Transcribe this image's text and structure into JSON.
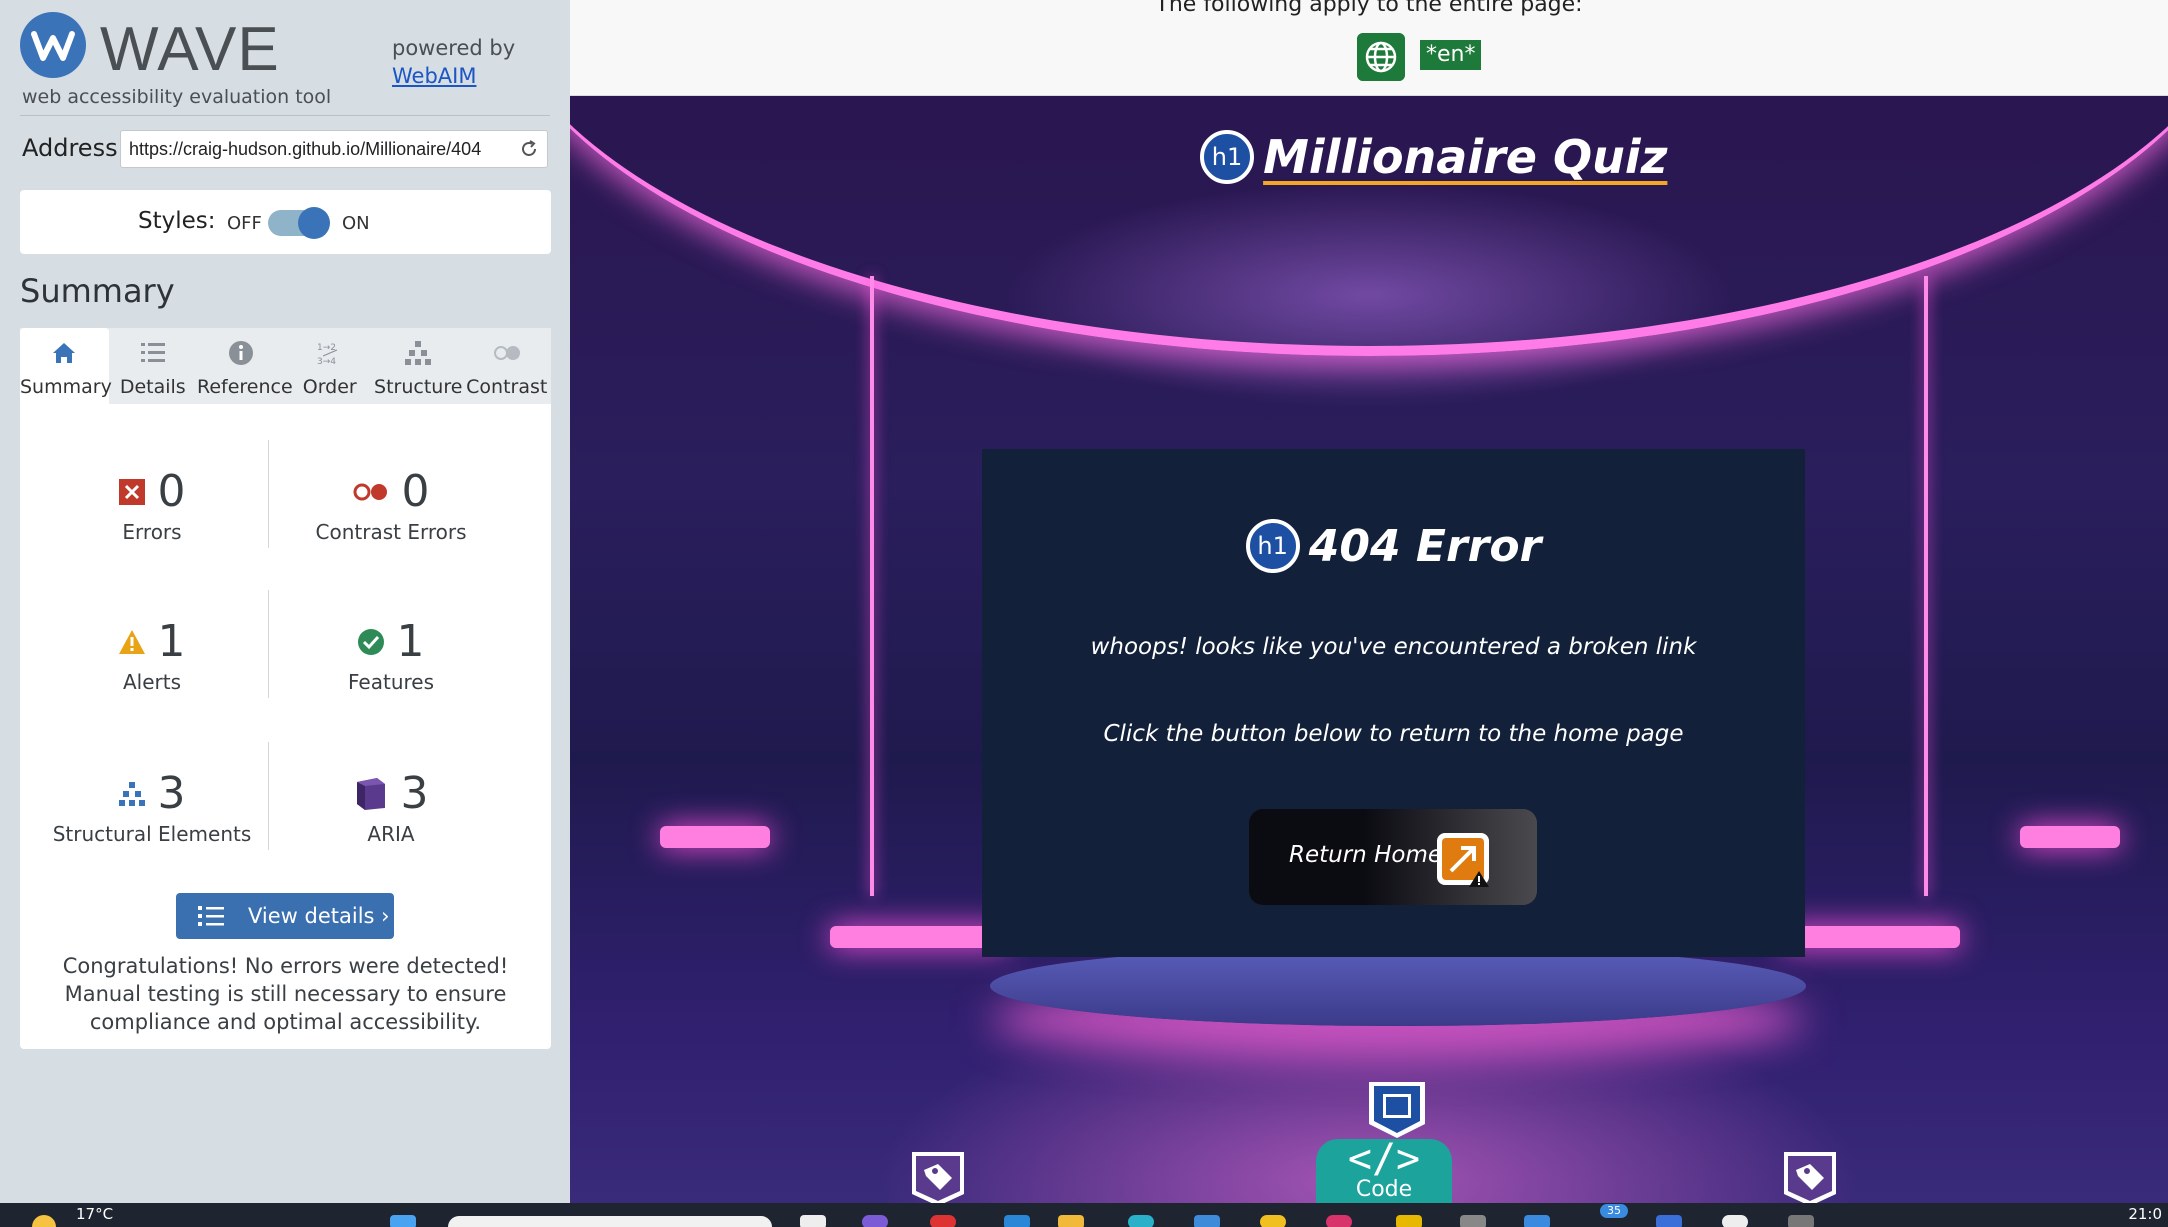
{
  "wave": {
    "logo_letter": "W",
    "brand_name": "WAVE",
    "subtitle": "web accessibility evaluation tool",
    "powered_by": "powered by",
    "webaim_link": "WebAIM",
    "address_label": "Address:",
    "address_value": "https://craig-hudson.github.io/Millionaire/404",
    "styles_label": "Styles:",
    "styles_off": "OFF",
    "styles_on": "ON",
    "styles_enabled": true,
    "summary_heading": "Summary",
    "tabs": [
      {
        "label": "Summary",
        "icon": "home-icon",
        "active": true
      },
      {
        "label": "Details",
        "icon": "list-icon",
        "active": false
      },
      {
        "label": "Reference",
        "icon": "info-icon",
        "active": false
      },
      {
        "label": "Order",
        "icon": "order-icon",
        "active": false
      },
      {
        "label": "Structure",
        "icon": "structure-icon",
        "active": false
      },
      {
        "label": "Contrast",
        "icon": "contrast-icon",
        "active": false
      }
    ],
    "stats": {
      "errors": {
        "count": "0",
        "label": "Errors"
      },
      "contrast_errors": {
        "count": "0",
        "label": "Contrast Errors"
      },
      "alerts": {
        "count": "1",
        "label": "Alerts"
      },
      "features": {
        "count": "1",
        "label": "Features"
      },
      "structural": {
        "count": "3",
        "label": "Structural Elements"
      },
      "aria": {
        "count": "3",
        "label": "ARIA"
      }
    },
    "view_details": "View details ›",
    "congrats": "Congratulations! No errors were detected! Manual testing is still necessary to ensure compliance and optimal accessibility.",
    "colors": {
      "accent": "#3b73b9",
      "error": "#c0392b",
      "alert": "#e8a317",
      "feature": "#2e8b57",
      "aria": "#5a3a8c"
    }
  },
  "page_header": {
    "apply_text": "The following apply to the entire page:",
    "lang_badge": "*en*"
  },
  "site": {
    "h1_marker": "h1",
    "title": "Millionaire Quiz",
    "error_heading": "404 Error",
    "message_1": "whoops! looks like you've encountered a broken link",
    "message_2": "Click the button below to return to the home page",
    "return_button": "Return Home",
    "code_glyph": "</>",
    "code_label": "Code"
  },
  "taskbar": {
    "weather": "17°C",
    "notification_count": "35",
    "time": "21:0"
  }
}
